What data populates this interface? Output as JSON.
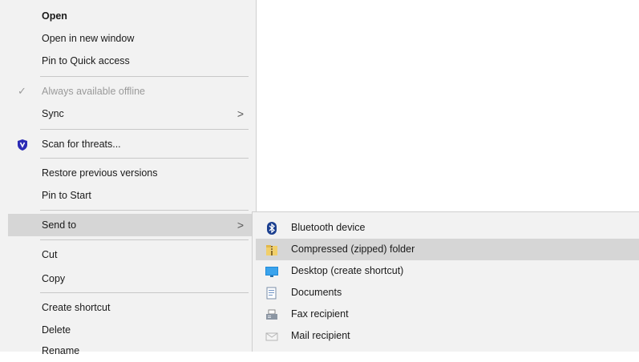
{
  "context_menu": {
    "items": [
      {
        "label": "Open"
      },
      {
        "label": "Open in new window"
      },
      {
        "label": "Pin to Quick access"
      },
      {
        "label": "Always available offline"
      },
      {
        "label": "Sync"
      },
      {
        "label": "Scan for threats..."
      },
      {
        "label": "Restore previous versions"
      },
      {
        "label": "Pin to Start"
      },
      {
        "label": "Send to"
      },
      {
        "label": "Cut"
      },
      {
        "label": "Copy"
      },
      {
        "label": "Create shortcut"
      },
      {
        "label": "Delete"
      },
      {
        "label": "Rename"
      }
    ]
  },
  "send_to_menu": {
    "items": [
      {
        "label": "Bluetooth device",
        "icon": "bluetooth-icon"
      },
      {
        "label": "Compressed (zipped) folder",
        "icon": "zip-folder-icon"
      },
      {
        "label": "Desktop (create shortcut)",
        "icon": "desktop-icon"
      },
      {
        "label": "Documents",
        "icon": "documents-icon"
      },
      {
        "label": "Fax recipient",
        "icon": "fax-icon"
      },
      {
        "label": "Mail recipient",
        "icon": "mail-icon"
      }
    ]
  },
  "colors": {
    "menu_bg": "#f2f2f2",
    "highlight": "#d6d6d6",
    "defender_shield": "#2b2bb5",
    "bluetooth": "#1b3f8f"
  }
}
